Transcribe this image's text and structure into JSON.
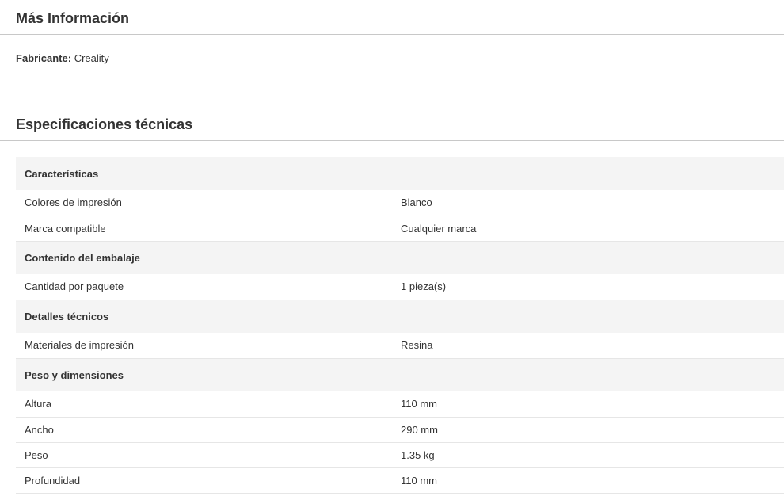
{
  "more_info": {
    "title": "Más Información",
    "manufacturer_label": "Fabricante:",
    "manufacturer_value": "Creality"
  },
  "specs": {
    "title": "Especificaciones técnicas",
    "groups": [
      {
        "name": "Características",
        "items": [
          {
            "label": "Colores de impresión",
            "value": "Blanco"
          },
          {
            "label": "Marca compatible",
            "value": "Cualquier marca"
          }
        ]
      },
      {
        "name": "Contenido del embalaje",
        "items": [
          {
            "label": "Cantidad por paquete",
            "value": "1 pieza(s)"
          }
        ]
      },
      {
        "name": "Detalles técnicos",
        "items": [
          {
            "label": "Materiales de impresión",
            "value": "Resina"
          }
        ]
      },
      {
        "name": "Peso y dimensiones",
        "items": [
          {
            "label": "Altura",
            "value": "110 mm"
          },
          {
            "label": "Ancho",
            "value": "290 mm"
          },
          {
            "label": "Peso",
            "value": "1.35 kg"
          },
          {
            "label": "Profundidad",
            "value": "110 mm"
          }
        ]
      }
    ]
  }
}
